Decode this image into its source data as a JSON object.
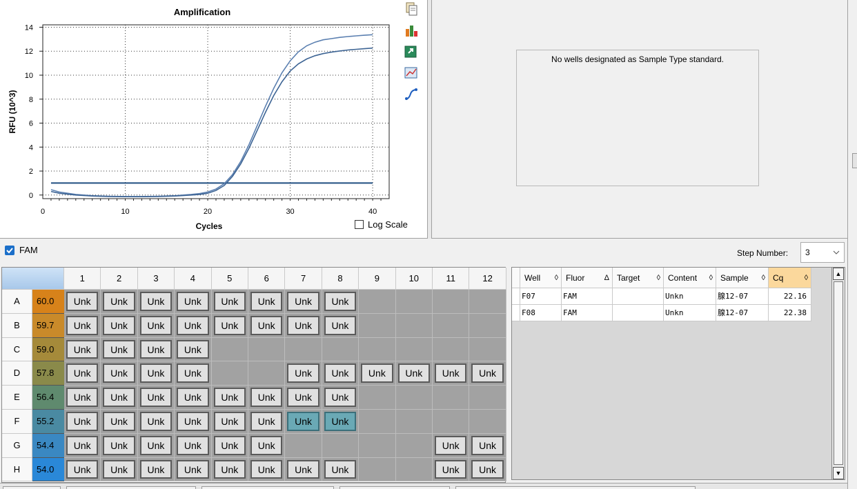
{
  "chart": {
    "title": "Amplification",
    "xlabel": "Cycles",
    "ylabel": "RFU (10^3)",
    "log_scale_label": "Log Scale",
    "log_scale_checked": false
  },
  "chart_data": {
    "type": "line",
    "title": "Amplification",
    "xlabel": "Cycles",
    "ylabel": "RFU (10^3)",
    "xlim": [
      0,
      42
    ],
    "ylim": [
      -0.3,
      14.2
    ],
    "xticks": [
      0,
      10,
      20,
      30,
      40
    ],
    "yticks": [
      0,
      2,
      4,
      6,
      8,
      10,
      12,
      14
    ],
    "grid": "dotted",
    "series": [
      {
        "color": "#5a7fb0",
        "x": [
          1,
          2,
          4,
          6,
          8,
          10,
          12,
          14,
          16,
          18,
          19,
          20,
          21,
          22,
          23,
          24,
          25,
          26,
          27,
          28,
          29,
          30,
          31,
          32,
          33,
          34,
          35,
          36,
          37,
          38,
          39,
          40
        ],
        "y": [
          0.45,
          0.25,
          0.05,
          -0.05,
          -0.1,
          -0.12,
          -0.12,
          -0.1,
          -0.05,
          0.05,
          0.12,
          0.25,
          0.5,
          0.95,
          1.7,
          2.8,
          4.2,
          5.8,
          7.4,
          8.9,
          10.2,
          11.2,
          11.95,
          12.45,
          12.75,
          12.95,
          13.05,
          13.15,
          13.22,
          13.28,
          13.33,
          13.38
        ]
      },
      {
        "color": "#3d6494",
        "x": [
          1,
          2,
          4,
          6,
          8,
          10,
          12,
          14,
          16,
          18,
          19,
          20,
          21,
          22,
          23,
          24,
          25,
          26,
          27,
          28,
          29,
          30,
          31,
          32,
          33,
          34,
          35,
          36,
          37,
          38,
          39,
          40
        ],
        "y": [
          0.3,
          0.15,
          0.0,
          -0.08,
          -0.12,
          -0.14,
          -0.14,
          -0.12,
          -0.08,
          0.0,
          0.05,
          0.15,
          0.38,
          0.8,
          1.55,
          2.6,
          3.9,
          5.4,
          6.9,
          8.3,
          9.45,
          10.35,
          10.95,
          11.35,
          11.62,
          11.8,
          11.92,
          12.02,
          12.1,
          12.16,
          12.21,
          12.26
        ]
      }
    ],
    "threshold": 1.0,
    "threshold_color": "#1f4e80"
  },
  "standard": {
    "message": "No wells designated as Sample Type standard."
  },
  "toolbar_icons": [
    "copy-icon",
    "chart-export-icon",
    "export-icon",
    "zoom-chart-icon",
    "curve-fit-icon"
  ],
  "fluor": {
    "label": "FAM",
    "checked": true
  },
  "step": {
    "label": "Step Number:",
    "value": "3"
  },
  "plate": {
    "columns": [
      "1",
      "2",
      "3",
      "4",
      "5",
      "6",
      "7",
      "8",
      "9",
      "10",
      "11",
      "12"
    ],
    "rows": [
      {
        "label": "A",
        "temp": "60.0",
        "temp_color": "#d7821a",
        "wells": [
          "Unk",
          "Unk",
          "Unk",
          "Unk",
          "Unk",
          "Unk",
          "Unk",
          "Unk",
          "",
          "",
          "",
          ""
        ]
      },
      {
        "label": "B",
        "temp": "59.7",
        "temp_color": "#c98a2a",
        "wells": [
          "Unk",
          "Unk",
          "Unk",
          "Unk",
          "Unk",
          "Unk",
          "Unk",
          "Unk",
          "",
          "",
          "",
          ""
        ]
      },
      {
        "label": "C",
        "temp": "59.0",
        "temp_color": "#a58a3a",
        "wells": [
          "Unk",
          "Unk",
          "Unk",
          "Unk",
          "",
          "",
          "",
          "",
          "",
          "",
          "",
          ""
        ]
      },
      {
        "label": "D",
        "temp": "57.8",
        "temp_color": "#8a8a4a",
        "wells": [
          "Unk",
          "Unk",
          "Unk",
          "Unk",
          "",
          "",
          "Unk",
          "Unk",
          "Unk",
          "Unk",
          "Unk",
          "Unk"
        ]
      },
      {
        "label": "E",
        "temp": "56.4",
        "temp_color": "#5f8a6e",
        "wells": [
          "Unk",
          "Unk",
          "Unk",
          "Unk",
          "Unk",
          "Unk",
          "Unk",
          "Unk",
          "",
          "",
          "",
          ""
        ]
      },
      {
        "label": "F",
        "temp": "55.2",
        "temp_color": "#4a8aa2",
        "wells": [
          "Unk",
          "Unk",
          "Unk",
          "Unk",
          "Unk",
          "Unk",
          "Unk",
          "Unk",
          "",
          "",
          "",
          ""
        ]
      },
      {
        "label": "G",
        "temp": "54.4",
        "temp_color": "#3a88c2",
        "wells": [
          "Unk",
          "Unk",
          "Unk",
          "Unk",
          "Unk",
          "Unk",
          "",
          "",
          "",
          "",
          "Unk",
          "Unk"
        ]
      },
      {
        "label": "H",
        "temp": "54.0",
        "temp_color": "#2a88d8",
        "wells": [
          "Unk",
          "Unk",
          "Unk",
          "Unk",
          "Unk",
          "Unk",
          "Unk",
          "Unk",
          "",
          "",
          "Unk",
          "Unk"
        ]
      }
    ],
    "selected_wells": [
      "F7",
      "F8"
    ]
  },
  "results": {
    "columns": [
      {
        "label": "Well",
        "sort": "◊"
      },
      {
        "label": "Fluor",
        "sort": "Δ"
      },
      {
        "label": "Target",
        "sort": "◊"
      },
      {
        "label": "Content",
        "sort": "◊"
      },
      {
        "label": "Sample",
        "sort": "◊"
      },
      {
        "label": "Cq",
        "sort": "◊",
        "highlight": "#fbd89c"
      }
    ],
    "rows": [
      [
        "F07",
        "FAM",
        "",
        "Unkn",
        "腺12-07",
        "22.16"
      ],
      [
        "F08",
        "FAM",
        "",
        "Unkn",
        "腺12-07",
        "22.38"
      ]
    ]
  }
}
